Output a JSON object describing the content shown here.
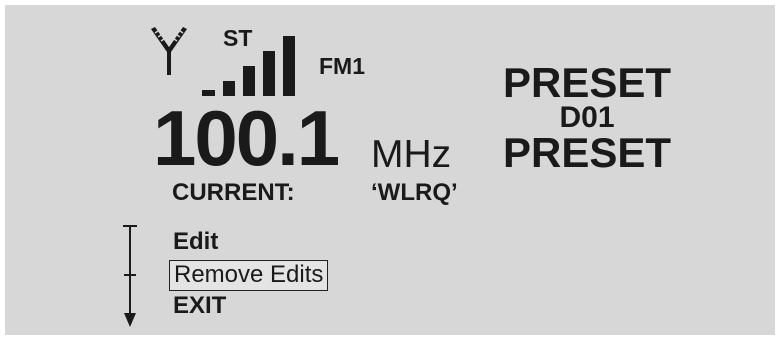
{
  "display": {
    "stereo_indicator": "ST",
    "band": "FM1",
    "frequency": "100.1",
    "unit": "MHz",
    "current_label": "CURRENT:",
    "station_name": "‘WLRQ’",
    "preset_heading": "PRESET",
    "preset_code": "D01",
    "preset_footer": "PRESET",
    "signal_level": {
      "filled_bars": 5,
      "total_bars": 5
    }
  },
  "menu": {
    "items": [
      {
        "label": "Edit",
        "selected": false
      },
      {
        "label": "Remove Edits",
        "selected": true
      },
      {
        "label": "EXIT",
        "selected": false
      }
    ]
  },
  "icons": {
    "antenna": "antenna-icon",
    "signal": "signal-strength-icon",
    "scroll": "scroll-indicator-icon"
  },
  "colors": {
    "screen_background": "#d7d7d7",
    "text": "#1a1a1a"
  }
}
